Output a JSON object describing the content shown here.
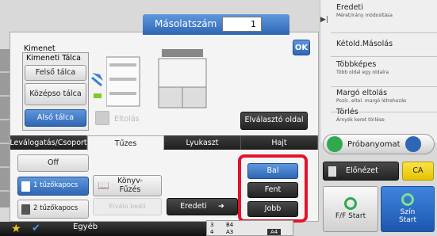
{
  "header": {
    "copies_label": "Másolatszám",
    "copies_value": "1",
    "ok_label": "OK"
  },
  "output": {
    "title": "Kimenet",
    "tray_title": "Kimeneti Tálca",
    "trays": [
      "Felső tálca",
      "Középso tálca",
      "Alsó tálca"
    ],
    "offset_label": "Eltolás",
    "separator_label": "Elválasztó oldal"
  },
  "tabs": [
    "Leválogatás/Csoport",
    "Tűzes",
    "Lyukaszt",
    "Hajt"
  ],
  "staple": {
    "off_label": "Off",
    "one_staple": "1 tűzőkapocs",
    "two_staple": "2 tűzőkapocs",
    "book_label": "Könyv-Fűzés",
    "staple_sep_label": "Elválo beáll",
    "original_label": "Eredeti",
    "positions": [
      "Bal",
      "Fent",
      "Jobb"
    ]
  },
  "right_panel": [
    {
      "title": "Eredeti",
      "sub": "Méret/irány módosítása"
    },
    {
      "title": "Kétold.Másolás",
      "sub": ""
    },
    {
      "title": "Többképes",
      "sub": "Több oldal egy oldalra"
    },
    {
      "title": "Margó eltolás",
      "sub": "Pozíc. eltol. margó létrehozás"
    },
    {
      "title": "Törlés",
      "sub": "Árnyék keret törlése"
    }
  ],
  "actions": {
    "proof_label": "Próbanyomat",
    "preview_label": "Előnézet",
    "ca_label": "CA",
    "bw_start": "F/F Start",
    "color_start": "Szín Start"
  },
  "bottom": {
    "other_label": "Egyéb",
    "paper_sizes": [
      "3",
      "4",
      "B4",
      "A3",
      "A4"
    ]
  },
  "colors": {
    "accent_blue": "#2e66b5",
    "highlight_red": "#e0142d",
    "ca_yellow": "#f0d000"
  }
}
